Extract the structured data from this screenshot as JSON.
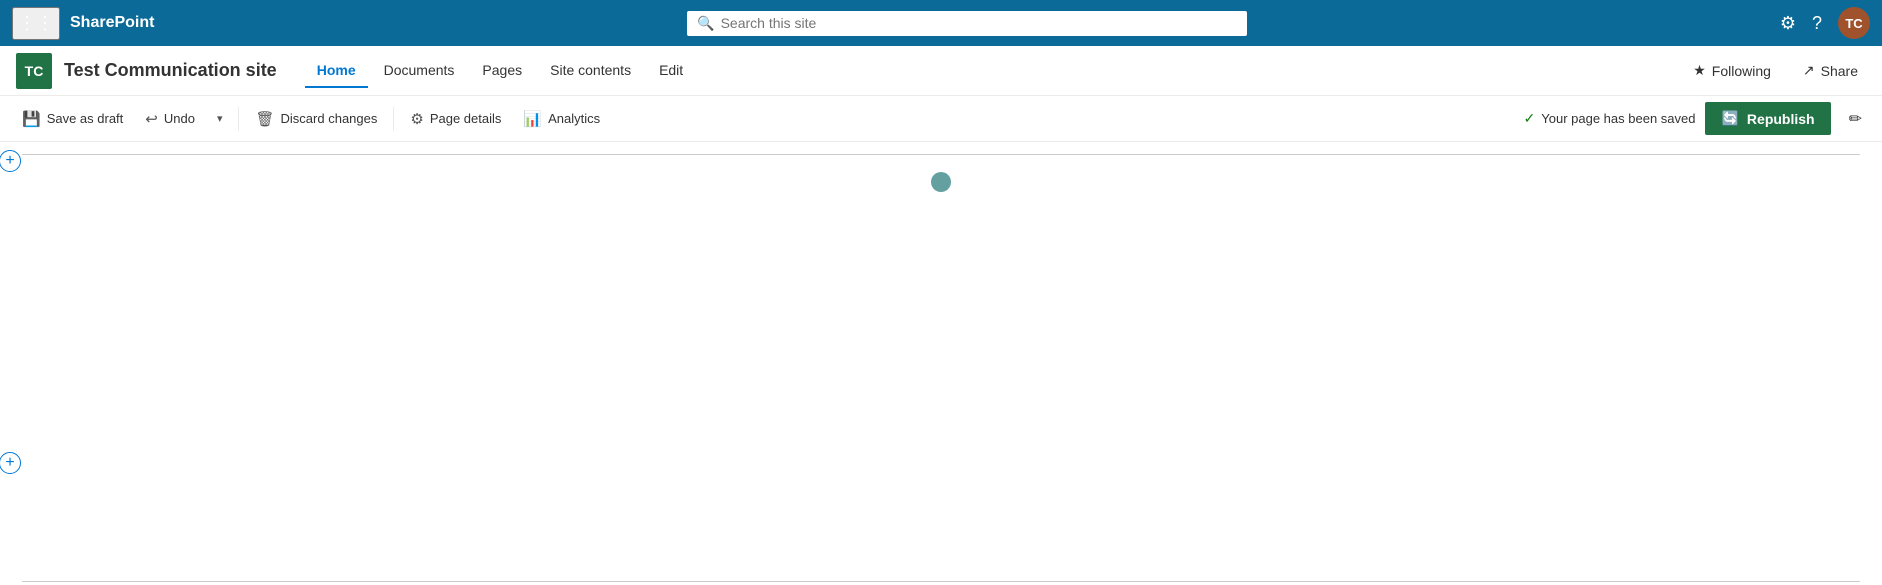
{
  "app": {
    "name": "SharePoint"
  },
  "topbar": {
    "title": "SharePoint",
    "search_placeholder": "Search this site",
    "settings_icon": "⚙",
    "help_icon": "?",
    "avatar_initials": "TC"
  },
  "navbar": {
    "site_initials": "TC",
    "site_name": "Test Communication site",
    "links": [
      {
        "label": "Home",
        "active": true
      },
      {
        "label": "Documents",
        "active": false
      },
      {
        "label": "Pages",
        "active": false
      },
      {
        "label": "Site contents",
        "active": false
      },
      {
        "label": "Edit",
        "active": false
      }
    ],
    "following_label": "Following",
    "share_label": "Share"
  },
  "toolbar": {
    "save_draft_label": "Save as draft",
    "undo_label": "Undo",
    "discard_label": "Discard changes",
    "page_details_label": "Page details",
    "analytics_label": "Analytics",
    "saved_message": "Your page has been saved",
    "republish_label": "Republish"
  },
  "content": {
    "add_section_label": "+"
  }
}
